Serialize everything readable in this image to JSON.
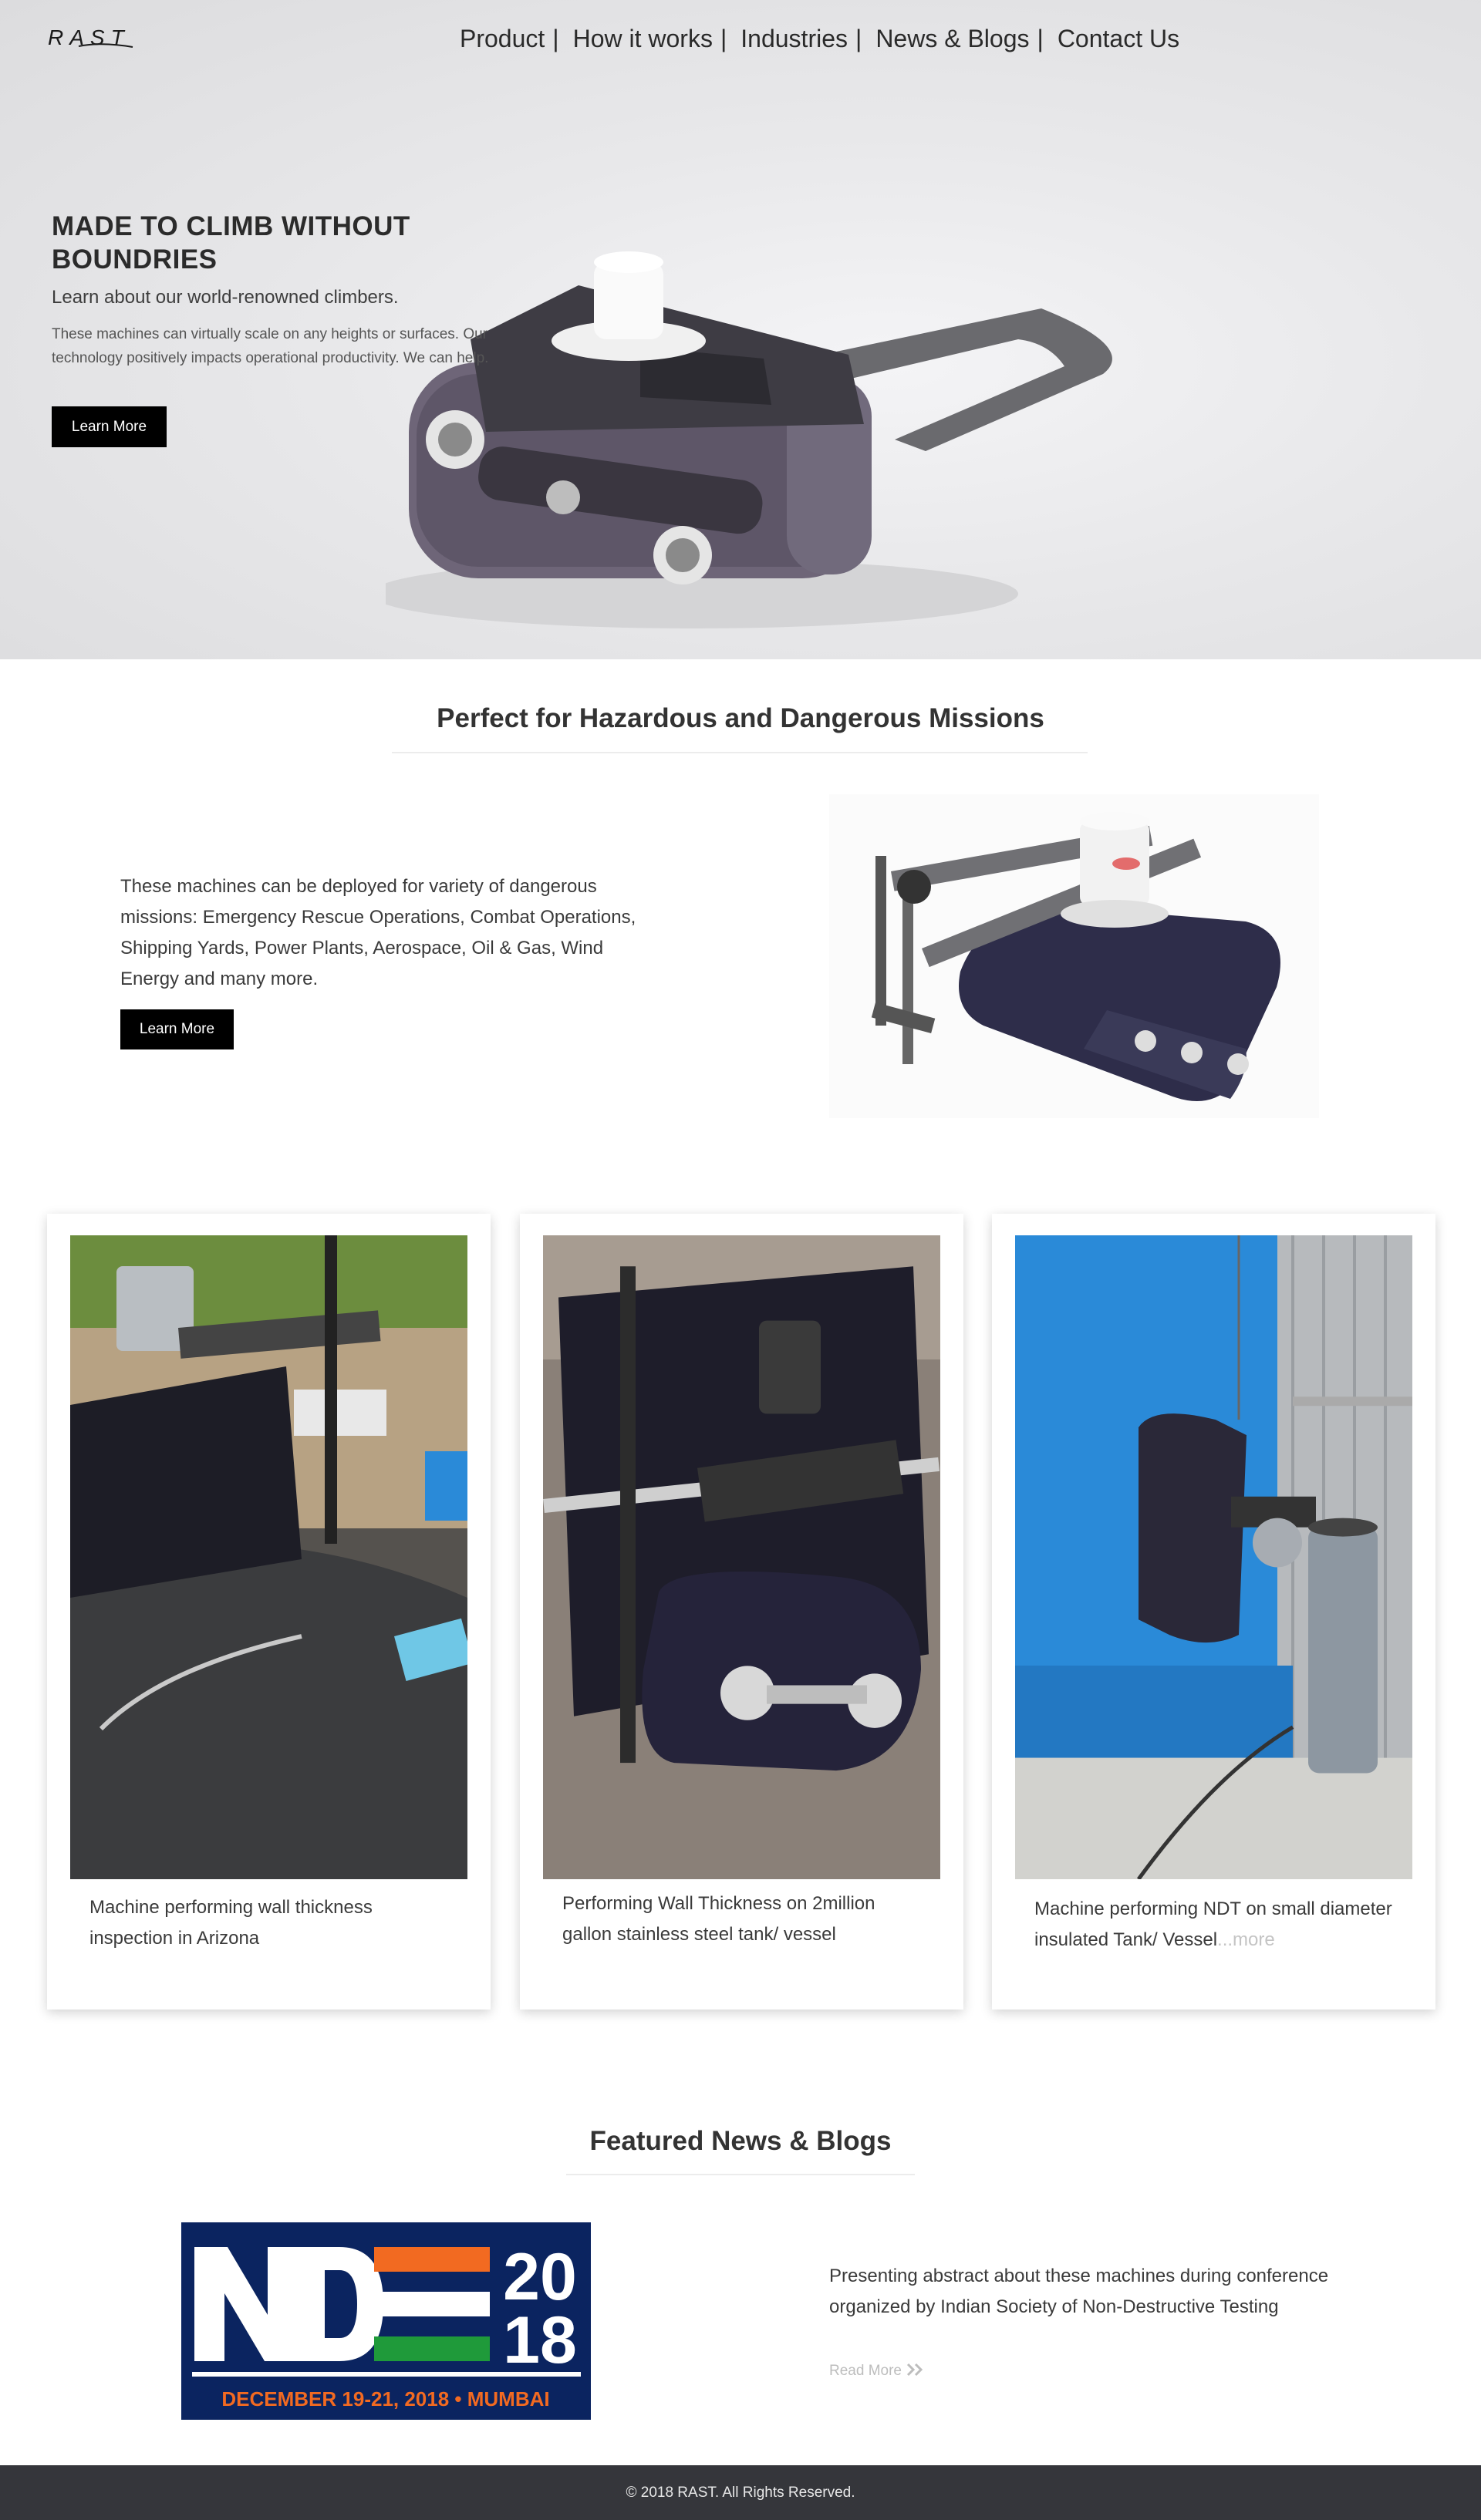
{
  "nav": {
    "logo_text": "RAST",
    "items": [
      "Product",
      "How it works",
      "Industries",
      "News & Blogs",
      "Contact Us"
    ],
    "separator": "|"
  },
  "hero": {
    "title": "MADE TO CLIMB WITHOUT BOUNDRIES",
    "subtitle": "Learn about our world-renowned climbers.",
    "text": "These machines can virtually scale on any heights or surfaces. Our technology positively impacts operational productivity. We can help.",
    "button": "Learn More"
  },
  "missions": {
    "title": "Perfect for Hazardous and Dangerous Missions",
    "text": "These machines can be deployed for variety of dangerous missions: Emergency Rescue Operations, Combat Operations, Shipping Yards, Power Plants, Aerospace, Oil & Gas, Wind Energy and many more.",
    "button": "Learn More"
  },
  "cards": [
    {
      "caption": "Machine performing wall thickness inspection in Arizona"
    },
    {
      "caption": "Performing Wall Thickness on 2million gallon stainless steel tank/ vessel"
    },
    {
      "caption": "Machine performing NDT on small diameter insulated Tank/ Vessel",
      "more": "...more"
    }
  ],
  "news": {
    "title": "Featured News & Blogs",
    "image_text": {
      "logo": "NDE",
      "year_top": "20",
      "year_bottom": "18",
      "dates": "DECEMBER 19-21, 2018 • MUMBAI"
    },
    "text": "Presenting abstract about these machines during conference organized by Indian Society of Non-Destructive Testing",
    "read_more": "Read More"
  },
  "footer": {
    "text": "© 2018 RAST. All Rights Reserved."
  },
  "colors": {
    "button_bg": "#000000",
    "footer_bg": "#35363b",
    "nde_blue": "#0b2460",
    "nde_orange": "#f26a21",
    "nde_green": "#1f9a3a",
    "tank_blue": "#2a8ad8"
  }
}
